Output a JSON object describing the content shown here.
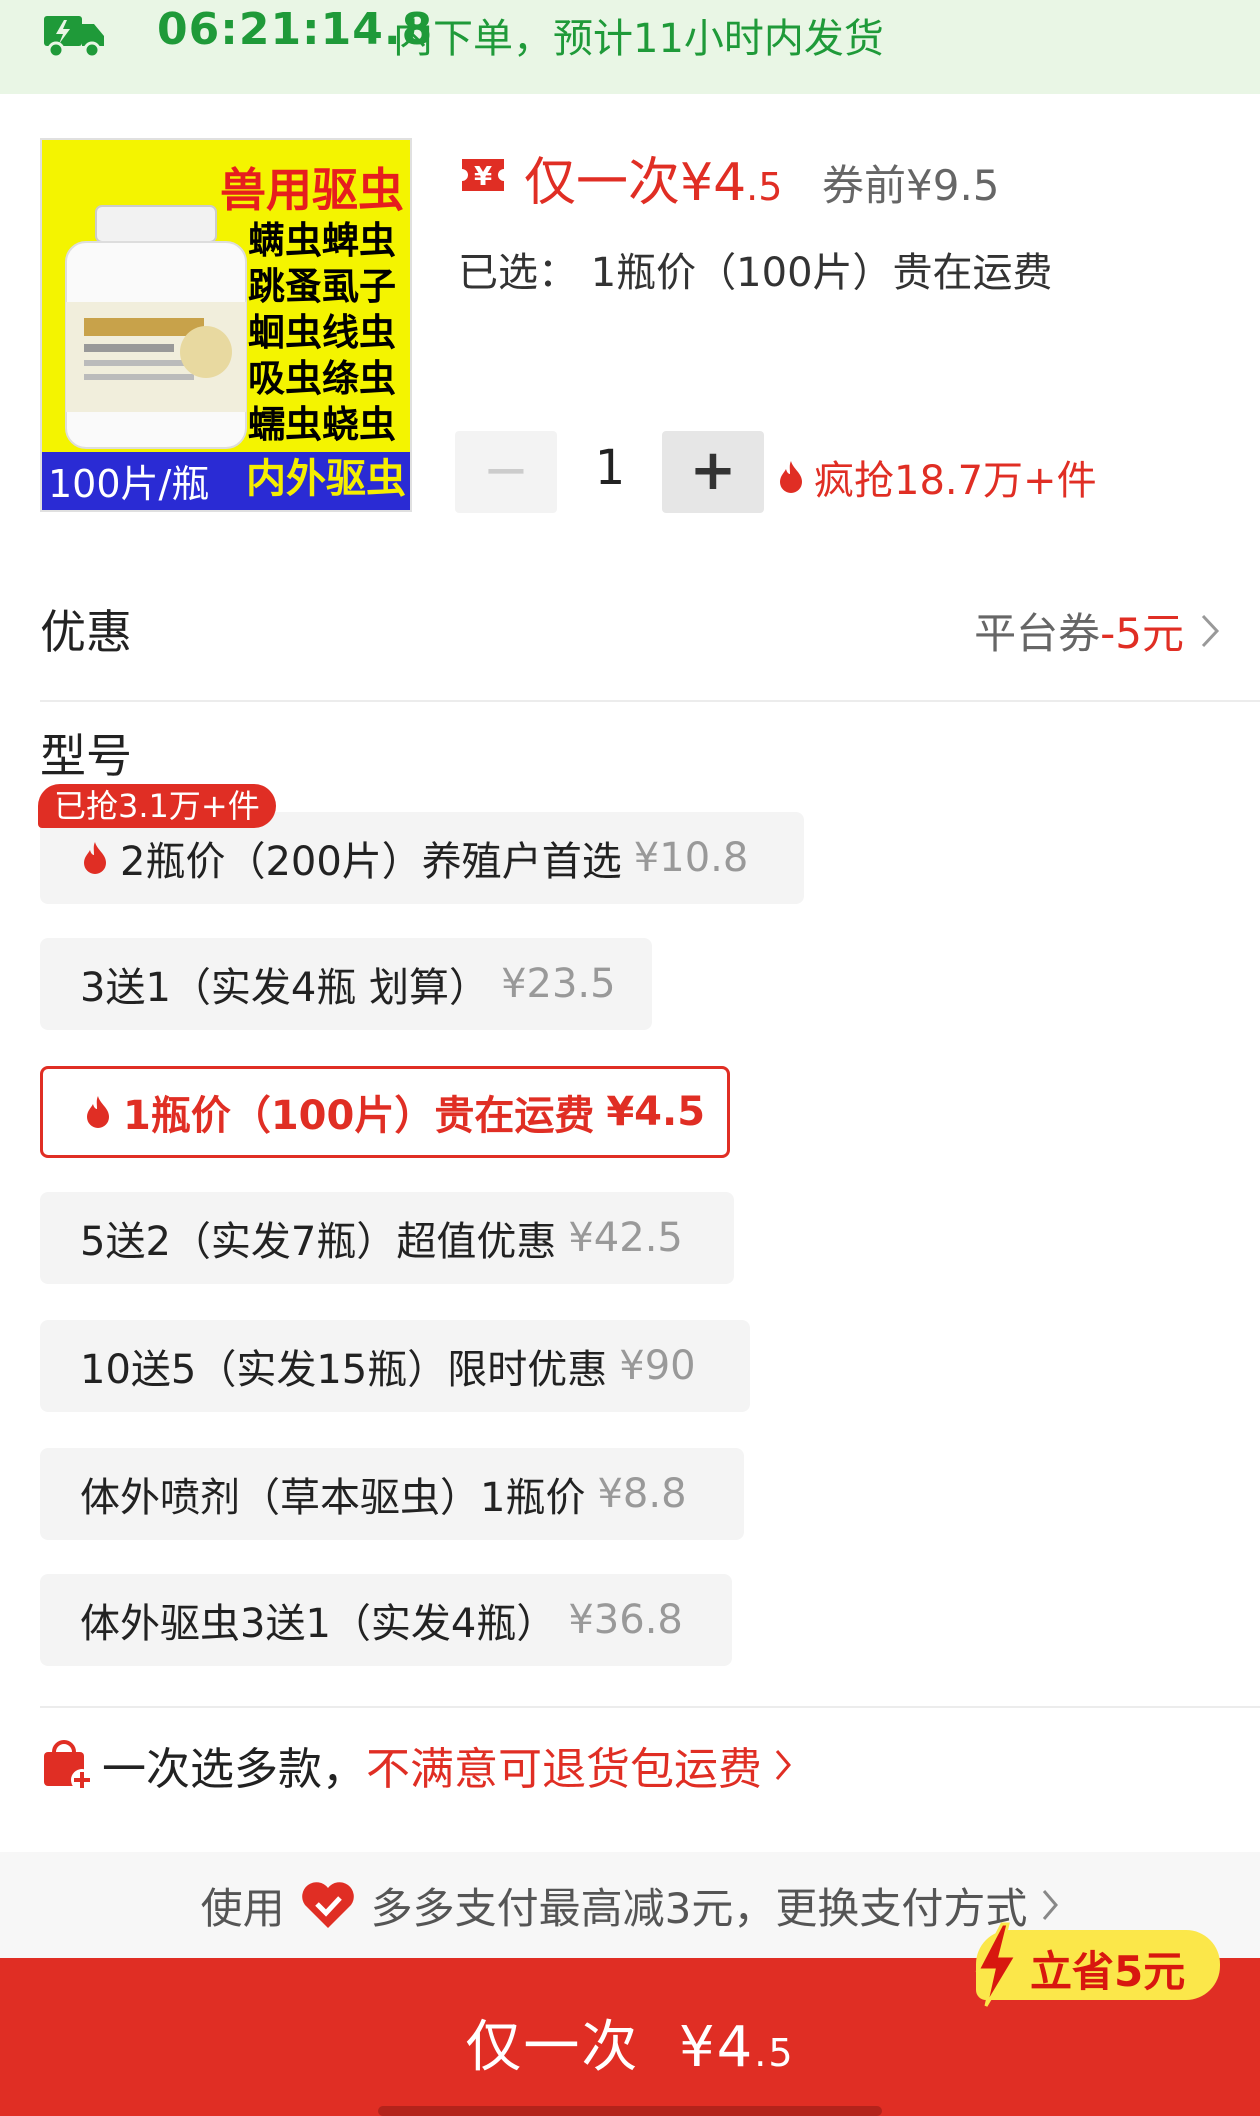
{
  "shipping": {
    "countdown": "06:21:14.8",
    "text": "内下单，预计11小时内发货",
    "icon": "truck-icon"
  },
  "product": {
    "image": {
      "title": "兽用驱虫",
      "lines": [
        "螨虫蜱虫",
        "跳蚤虱子",
        "蛔虫线虫",
        "吸虫绦虫",
        "蠕虫蛲虫"
      ],
      "bottom_left": "100片/瓶",
      "bottom_right": "内外驱虫"
    },
    "price_prefix": "仅一次¥4",
    "price_decimal": ".5",
    "price_before": "券前¥9.5",
    "selected_label": "已选：",
    "selected_value": "1瓶价（100片）贵在运费",
    "quantity": "1",
    "minus": "−",
    "plus": "+",
    "hot_sold": "疯抢18.7万+件"
  },
  "discount": {
    "label": "优惠",
    "coupon_text": "平台券",
    "coupon_value": "-5元"
  },
  "models": {
    "title": "型号",
    "hot_tag": "已抢3.1万+件",
    "options": [
      {
        "label": "2瓶价（200片）养殖户首选",
        "price": "¥10.8",
        "hot": true,
        "selected": false
      },
      {
        "label": "3送1（实发4瓶 划算）",
        "price": "¥23.5",
        "hot": false,
        "selected": false
      },
      {
        "label": "1瓶价（100片）贵在运费",
        "price": "¥4.5",
        "hot": true,
        "selected": true
      },
      {
        "label": "5送2（实发7瓶）超值优惠",
        "price": "¥42.5",
        "hot": false,
        "selected": false
      },
      {
        "label": "10送5（实发15瓶）限时优惠",
        "price": "¥90",
        "hot": false,
        "selected": false
      },
      {
        "label": "体外喷剂（草本驱虫）1瓶价",
        "price": "¥8.8",
        "hot": false,
        "selected": false
      },
      {
        "label": "体外驱虫3送1（实发4瓶）",
        "price": "¥36.8",
        "hot": false,
        "selected": false
      }
    ]
  },
  "multi": {
    "black": "一次选多款，",
    "red": "不满意可退货包运费"
  },
  "pay": {
    "prefix": "使用",
    "text": "多多支付最高减3元，更换支付方式"
  },
  "save_badge": "立省5元",
  "buy": {
    "label": "仅一次",
    "price_int": "¥4",
    "price_dec": ".5"
  },
  "colors": {
    "brand_red": "#e02e24",
    "ship_green": "#1f9a39",
    "badge_yellow": "#fbe74a"
  }
}
